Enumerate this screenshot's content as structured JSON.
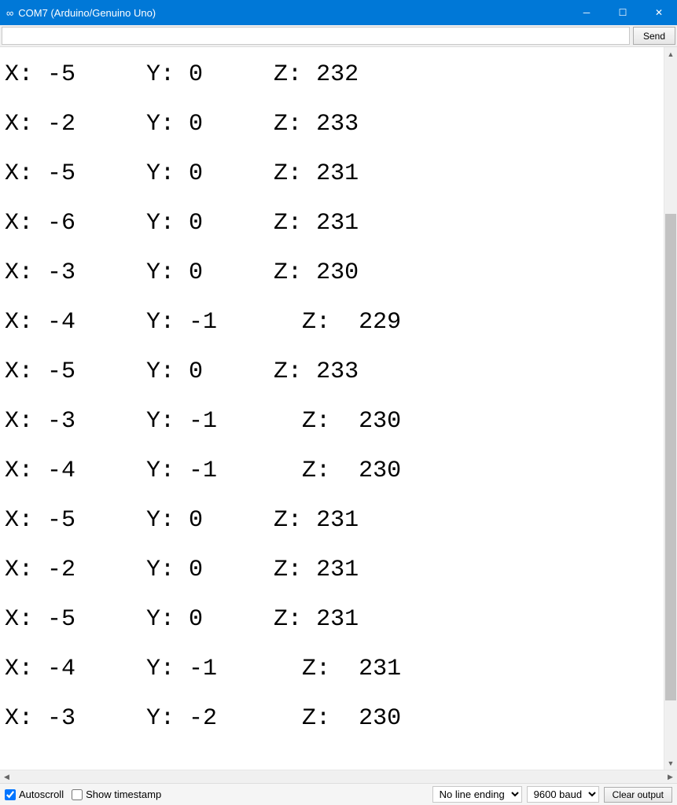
{
  "window": {
    "title": "COM7 (Arduino/Genuino Uno)"
  },
  "toolbar": {
    "input_placeholder": "",
    "send_label": "Send"
  },
  "serial": {
    "rows": [
      {
        "x": -5,
        "y": 0,
        "z": 232
      },
      {
        "x": -2,
        "y": 0,
        "z": 233
      },
      {
        "x": -5,
        "y": 0,
        "z": 231
      },
      {
        "x": -6,
        "y": 0,
        "z": 231
      },
      {
        "x": -3,
        "y": 0,
        "z": 230
      },
      {
        "x": -4,
        "y": -1,
        "z": 229
      },
      {
        "x": -5,
        "y": 0,
        "z": 233
      },
      {
        "x": -3,
        "y": -1,
        "z": 230
      },
      {
        "x": -4,
        "y": -1,
        "z": 230
      },
      {
        "x": -5,
        "y": 0,
        "z": 231
      },
      {
        "x": -2,
        "y": 0,
        "z": 231
      },
      {
        "x": -5,
        "y": 0,
        "z": 231
      },
      {
        "x": -4,
        "y": -1,
        "z": 231
      },
      {
        "x": -3,
        "y": -2,
        "z": 230
      }
    ]
  },
  "statusbar": {
    "autoscroll_label": "Autoscroll",
    "autoscroll_checked": true,
    "timestamp_label": "Show timestamp",
    "timestamp_checked": false,
    "line_ending": "No line ending",
    "baud": "9600 baud",
    "clear_label": "Clear output"
  }
}
